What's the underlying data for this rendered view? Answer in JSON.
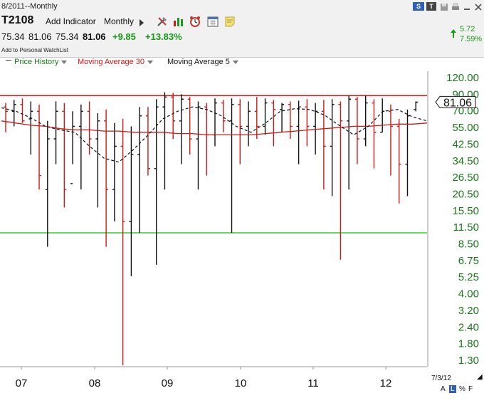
{
  "header": {
    "range_label": "8/2011--Monthly",
    "symbol": "T2108",
    "add_indicator": "Add Indicator",
    "period": "Monthly",
    "open": "75.34",
    "high": "81.06",
    "low": "75.34",
    "close": "81.06",
    "change": "+9.85",
    "change_pct": "+13.83%",
    "watchlist_link": "Add to Personal WatchList",
    "mini_value": "5.72",
    "mini_pct": "7.59%",
    "btn_s": "S",
    "btn_t": "T",
    "colors": {
      "up": "#1a9a1a",
      "down": "#d01818",
      "ma30": "#d01818",
      "ma5": "#111111"
    }
  },
  "indicator_bar": {
    "price_history": "Price History",
    "ma30": "Moving Average 30",
    "ma5": "Moving Average 5"
  },
  "chart_data": {
    "type": "bar",
    "subtype": "ohlc",
    "scale": "log",
    "y_ticks": [
      "120.00",
      "90.00",
      "70.00",
      "55.00",
      "42.50",
      "34.50",
      "26.50",
      "20.50",
      "15.50",
      "11.50",
      "8.50",
      "6.75",
      "5.25",
      "4.00",
      "3.20",
      "2.40",
      "1.80",
      "1.30"
    ],
    "x_ticks": [
      "07",
      "08",
      "09",
      "10",
      "11",
      "12"
    ],
    "last_value_label": "81.06",
    "date_label": "7/3/12",
    "ylim": [
      1.1,
      130
    ],
    "horizontal_lines": [
      {
        "value": 90,
        "color": "#e01818"
      },
      {
        "value": 10,
        "color": "#33cc33"
      }
    ],
    "moving_average_30": [
      60,
      58,
      56,
      55,
      53,
      52,
      52,
      51,
      51,
      50,
      50,
      50,
      49,
      49,
      48,
      48,
      48,
      48,
      49,
      50,
      51,
      52,
      53,
      54,
      55,
      55,
      56,
      57,
      57,
      58
    ],
    "moving_average_5": [
      74,
      70,
      63,
      55,
      52,
      50,
      40,
      33,
      31,
      38,
      48,
      62,
      70,
      75,
      72,
      65,
      55,
      50,
      58,
      70,
      73,
      72,
      66,
      56,
      48,
      55,
      70,
      72,
      64,
      60
    ],
    "bars": [
      {
        "h": 80,
        "l": 50,
        "o": 75,
        "c": 70
      },
      {
        "h": 84,
        "l": 55,
        "o": 70,
        "c": 78
      },
      {
        "h": 86,
        "l": 58,
        "o": 78,
        "c": 60
      },
      {
        "h": 82,
        "l": 35,
        "o": 62,
        "c": 70
      },
      {
        "h": 78,
        "l": 20,
        "o": 70,
        "c": 25
      },
      {
        "h": 60,
        "l": 8,
        "o": 20,
        "c": 45
      },
      {
        "h": 82,
        "l": 30,
        "o": 45,
        "c": 70
      },
      {
        "h": 80,
        "l": 15,
        "o": 70,
        "c": 20
      },
      {
        "h": 70,
        "l": 30,
        "o": 22,
        "c": 55
      },
      {
        "h": 78,
        "l": 20,
        "o": 55,
        "c": 70
      },
      {
        "h": 82,
        "l": 35,
        "o": 70,
        "c": 45
      },
      {
        "h": 68,
        "l": 15,
        "o": 45,
        "c": 60
      },
      {
        "h": 72,
        "l": 8,
        "o": 60,
        "c": 20
      },
      {
        "h": 58,
        "l": 12,
        "o": 20,
        "c": 40
      },
      {
        "h": 62,
        "l": 1.2,
        "o": 40,
        "c": 12
      },
      {
        "h": 55,
        "l": 5,
        "o": 12,
        "c": 35
      },
      {
        "h": 75,
        "l": 10,
        "o": 35,
        "c": 65
      },
      {
        "h": 75,
        "l": 25,
        "o": 65,
        "c": 28
      },
      {
        "h": 85,
        "l": 6,
        "o": 28,
        "c": 75
      },
      {
        "h": 95,
        "l": 20,
        "o": 75,
        "c": 88
      },
      {
        "h": 94,
        "l": 45,
        "o": 88,
        "c": 60
      },
      {
        "h": 92,
        "l": 30,
        "o": 60,
        "c": 85
      },
      {
        "h": 88,
        "l": 35,
        "o": 85,
        "c": 45
      },
      {
        "h": 82,
        "l": 20,
        "o": 45,
        "c": 75
      },
      {
        "h": 80,
        "l": 25,
        "o": 75,
        "c": 48
      },
      {
        "h": 86,
        "l": 40,
        "o": 48,
        "c": 80
      },
      {
        "h": 84,
        "l": 50,
        "o": 80,
        "c": 60
      },
      {
        "h": 86,
        "l": 10,
        "o": 60,
        "c": 78
      },
      {
        "h": 85,
        "l": 30,
        "o": 78,
        "c": 55
      },
      {
        "h": 82,
        "l": 40,
        "o": 55,
        "c": 70
      },
      {
        "h": 88,
        "l": 45,
        "o": 70,
        "c": 55
      },
      {
        "h": 86,
        "l": 48,
        "o": 55,
        "c": 80
      },
      {
        "h": 84,
        "l": 40,
        "o": 80,
        "c": 72
      },
      {
        "h": 80,
        "l": 50,
        "o": 72,
        "c": 78
      },
      {
        "h": 82,
        "l": 45,
        "o": 78,
        "c": 55
      },
      {
        "h": 83,
        "l": 30,
        "o": 55,
        "c": 75
      },
      {
        "h": 85,
        "l": 40,
        "o": 75,
        "c": 55
      },
      {
        "h": 80,
        "l": 35,
        "o": 55,
        "c": 70
      },
      {
        "h": 84,
        "l": 20,
        "o": 70,
        "c": 40
      },
      {
        "h": 85,
        "l": 18,
        "o": 40,
        "c": 78
      },
      {
        "h": 82,
        "l": 6.5,
        "o": 78,
        "c": 60
      },
      {
        "h": 90,
        "l": 20,
        "o": 60,
        "c": 85
      },
      {
        "h": 88,
        "l": 30,
        "o": 85,
        "c": 45
      },
      {
        "h": 90,
        "l": 40,
        "o": 45,
        "c": 80
      },
      {
        "h": 85,
        "l": 28,
        "o": 80,
        "c": 50
      },
      {
        "h": 86,
        "l": 50,
        "o": 50,
        "c": 70
      },
      {
        "h": 78,
        "l": 25,
        "o": 70,
        "c": 55
      },
      {
        "h": 62,
        "l": 16,
        "o": 55,
        "c": 30
      },
      {
        "h": 72,
        "l": 18,
        "o": 30,
        "c": 65
      },
      {
        "h": 82,
        "l": 70,
        "o": 72,
        "c": 81
      }
    ]
  },
  "footer": {
    "a": "A",
    "l": "L",
    "pct": "%",
    "f": "F"
  }
}
